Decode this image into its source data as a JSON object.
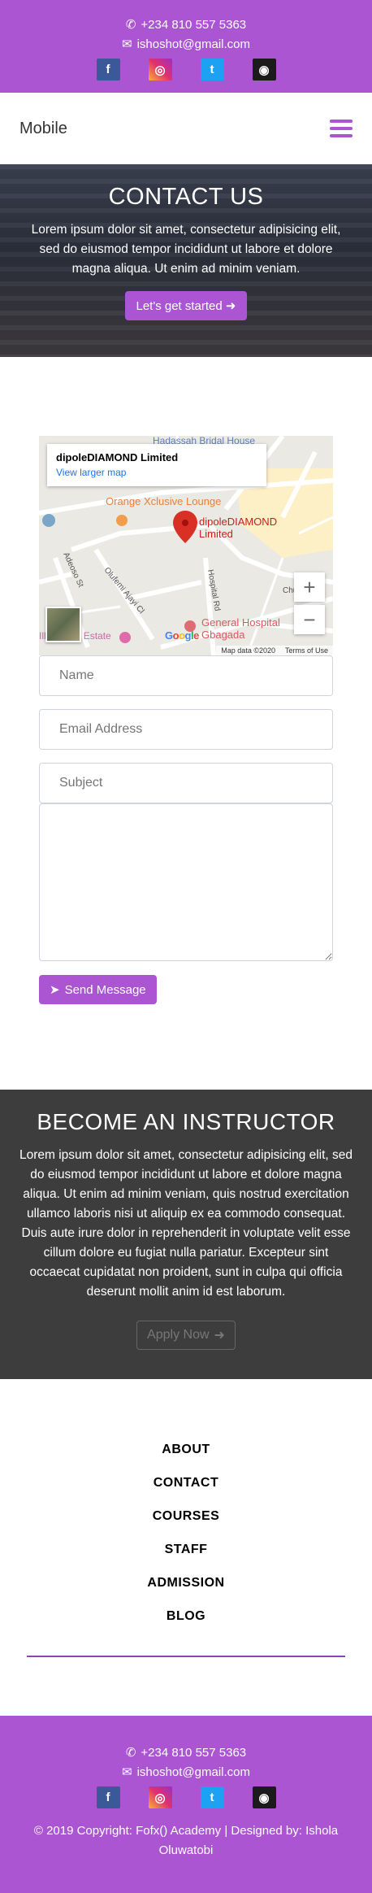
{
  "topbar": {
    "phone": "+234 810 557 5363",
    "email": "ishoshot@gmail.com",
    "socials": [
      {
        "name": "facebook",
        "glyph": "f"
      },
      {
        "name": "instagram",
        "glyph": "◎"
      },
      {
        "name": "twitter",
        "glyph": "t"
      },
      {
        "name": "github",
        "glyph": "◉"
      }
    ]
  },
  "navbar": {
    "brand": "Mobile"
  },
  "hero": {
    "title": "CONTACT US",
    "text": "Lorem ipsum dolor sit amet, consectetur adipisicing elit, sed do eiusmod tempor incididunt ut labore et dolore magna aliqua. Ut enim ad minim veniam.",
    "button": "Let's get started"
  },
  "map": {
    "place_name": "dipoleDIAMOND Limited",
    "larger_map_link": "View larger map",
    "labels": {
      "bridal": "Hadassah Bridal House",
      "lounge": "Orange Xclusive Lounge",
      "pin": "dipoleDIAMOND Limited",
      "hospital": "General Hospital Gbagada",
      "church": "Church St",
      "hospital_rd": "Hospital Rd",
      "adeoso": "Adeoso St",
      "olufemi": "Olufemi Ajayi Cl",
      "estate": "Estate"
    },
    "google": "Google",
    "attribution": "Map data ©2020",
    "terms": "Terms of Use"
  },
  "form": {
    "name_placeholder": "Name",
    "email_placeholder": "Email Address",
    "subject_placeholder": "Subject",
    "message_placeholder": "",
    "submit": "Send Message"
  },
  "instructor": {
    "title": "BECOME AN INSTRUCTOR",
    "text": "Lorem ipsum dolor sit amet, consectetur adipisicing elit, sed do eiusmod tempor incididunt ut labore et dolore magna aliqua. Ut enim ad minim veniam, quis nostrud exercitation ullamco laboris nisi ut aliquip ex ea commodo consequat. Duis aute irure dolor in reprehenderit in voluptate velit esse cillum dolore eu fugiat nulla pariatur. Excepteur sint occaecat cupidatat non proident, sunt in culpa qui officia deserunt mollit anim id est laborum.",
    "button": "Apply Now"
  },
  "footer_nav": [
    "ABOUT",
    "CONTACT",
    "COURSES",
    "STAFF",
    "ADMISSION",
    "BLOG"
  ],
  "footer": {
    "phone": "+234 810 557 5363",
    "email": "ishoshot@gmail.com",
    "copyright": "© 2019 Copyright: Fofx() Academy | Designed by: Ishola Oluwatobi"
  },
  "colors": {
    "brand_purple": "#ab55d3",
    "dark_section": "#3d3d3d"
  }
}
